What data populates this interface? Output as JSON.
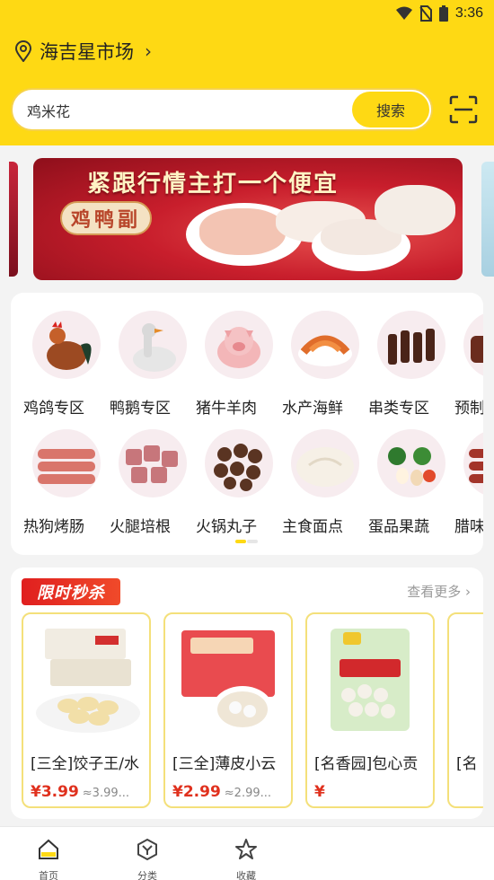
{
  "status_bar": {
    "time": "3:36"
  },
  "location": {
    "name": "海吉星市场"
  },
  "search": {
    "value": "鸡米花",
    "button_label": "搜索"
  },
  "banner": {
    "title": "紧跟行情主打一个便宜",
    "badge": "鸡鸭副"
  },
  "categories": [
    {
      "label": "鸡鸽专区",
      "icon": "rooster-icon"
    },
    {
      "label": "鸭鹅专区",
      "icon": "goose-icon"
    },
    {
      "label": "猪牛羊肉",
      "icon": "pig-icon"
    },
    {
      "label": "水产海鲜",
      "icon": "shrimp-icon"
    },
    {
      "label": "串类专区",
      "icon": "skewer-icon"
    },
    {
      "label": "预制",
      "icon": "prepared-food-icon"
    },
    {
      "label": "热狗烤肠",
      "icon": "sausage-icon"
    },
    {
      "label": "火腿培根",
      "icon": "ham-icon"
    },
    {
      "label": "火锅丸子",
      "icon": "meatball-icon"
    },
    {
      "label": "主食面点",
      "icon": "bun-icon"
    },
    {
      "label": "蛋品果蔬",
      "icon": "vegetable-icon"
    },
    {
      "label": "腊味",
      "icon": "cured-sausage-icon"
    }
  ],
  "flash_sale": {
    "title": "限时秒杀",
    "more_label": "查看更多",
    "products": [
      {
        "name": "[三全]饺子王/水",
        "price": "¥3.99",
        "original": "≈3.99..."
      },
      {
        "name": "[三全]薄皮小云",
        "price": "¥2.99",
        "original": "≈2.99..."
      },
      {
        "name": "[名香园]包心贡",
        "price": "¥",
        "original": ""
      },
      {
        "name": "[名",
        "price": "",
        "original": ""
      }
    ]
  },
  "nav": [
    {
      "label": "首页",
      "icon": "home-icon",
      "active": true
    },
    {
      "label": "分类",
      "icon": "category-icon",
      "active": false
    },
    {
      "label": "收藏",
      "icon": "star-icon",
      "active": false
    }
  ],
  "colors": {
    "brand_yellow": "#fed914",
    "price_red": "#e0311e"
  }
}
